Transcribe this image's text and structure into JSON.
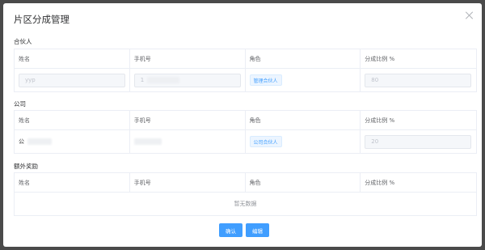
{
  "dialog": {
    "title": "片区分成管理"
  },
  "partner": {
    "label": "合伙人",
    "headers": [
      "姓名",
      "手机号",
      "角色",
      "分成比例 %"
    ],
    "row": {
      "name": "yyp",
      "phone": "1",
      "role": "管理合伙人",
      "ratio": "80"
    }
  },
  "company": {
    "label": "公司",
    "headers": [
      "姓名",
      "手机号",
      "角色",
      "分成比例 %"
    ],
    "row": {
      "name": "公",
      "role": "公司合伙人",
      "ratio": "20"
    }
  },
  "bonus": {
    "label": "额外奖励",
    "headers": [
      "姓名",
      "手机号",
      "角色",
      "分成比例 %"
    ],
    "empty_text": "暂无数据"
  },
  "footer": {
    "confirm_label": "确认",
    "edit_label": "编辑"
  }
}
